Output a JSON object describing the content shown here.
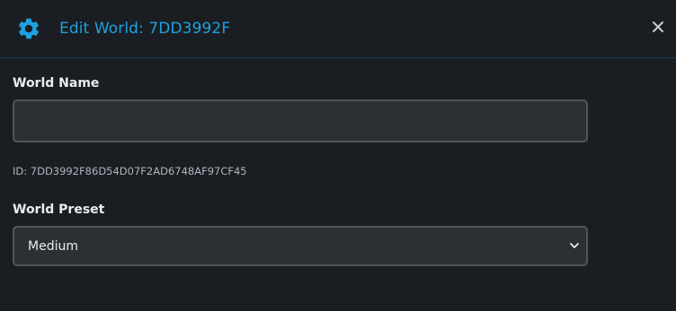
{
  "header": {
    "title": "Edit World: 7DD3992F",
    "icon": "gear-icon",
    "close_icon": "close-icon",
    "accent_color": "#1fa1e0"
  },
  "form": {
    "world_name": {
      "label": "World Name",
      "value": "",
      "placeholder": ""
    },
    "id_text": "ID: 7DD3992F86D54D07F2AD6748AF97CF45",
    "world_preset": {
      "label": "World Preset",
      "selected": "Medium"
    }
  }
}
